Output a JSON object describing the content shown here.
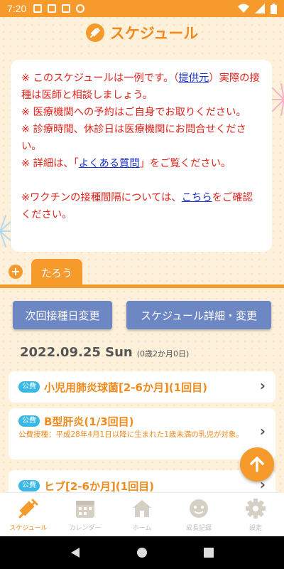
{
  "status_bar": {
    "time": "7:20"
  },
  "header": {
    "title": "スケジュール"
  },
  "notice": {
    "line1_before": "※ このスケジュールは一例です。（",
    "line1_link": "提供元",
    "line1_after": "）実際の接種は医師と相談しましょう。",
    "line2": "※ 医療機関への予約はご自身でお取りください。",
    "line3": "※ 診療時間、休診日は医療機関にお問合せください。",
    "line4_before": "※ 詳細は、「",
    "line4_link": "よくある質問",
    "line4_after": "」をご覧ください。",
    "line5_before": "※ワクチンの接種間隔については、",
    "line5_link": "こちら",
    "line5_after": "をご確認ください。"
  },
  "child_tab": {
    "add_label": "+",
    "name": "たろう"
  },
  "actions": {
    "next_date_change": "次回接種日変更",
    "schedule_detail": "スケジュール詳細・変更"
  },
  "date_header": {
    "date": "2022.09.25 Sun",
    "age": "(0歳2か月0日)"
  },
  "vaccines": [
    {
      "badge": "公費",
      "name": "小児用肺炎球菌[2-6か月](1回目)",
      "note": ""
    },
    {
      "badge": "公費",
      "name": "B型肝炎(1/3回目)",
      "note": "公費接種：平成28年4月1日以降に生まれた1歳未満の乳児が対象。"
    },
    {
      "badge": "公費",
      "name": "ヒブ[2-6か月](1回目)",
      "note": ""
    }
  ],
  "bottom_nav": [
    {
      "label": "スケジュール",
      "icon": "syringe-icon",
      "active": true
    },
    {
      "label": "カレンダー",
      "icon": "calendar-icon",
      "active": false
    },
    {
      "label": "ホーム",
      "icon": "home-icon",
      "active": false
    },
    {
      "label": "成長記録",
      "icon": "face-icon",
      "active": false
    },
    {
      "label": "設定",
      "icon": "gear-icon",
      "active": false
    }
  ],
  "colors": {
    "accent": "#f59a2b",
    "button": "#6d87c4",
    "badge": "#37b8e6",
    "notice_text": "#e0241b",
    "link": "#1a30c8"
  }
}
